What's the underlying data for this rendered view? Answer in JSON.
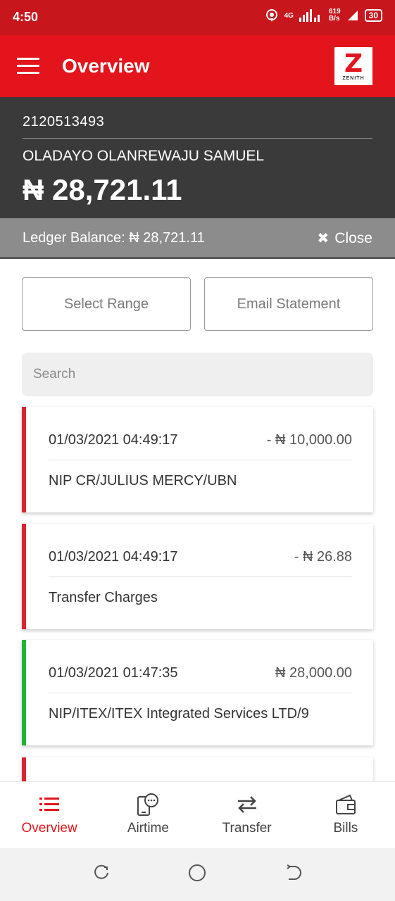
{
  "status_bar": {
    "time": "4:50",
    "network": "4G",
    "speed_value": "619",
    "speed_unit": "B/s",
    "battery": "30"
  },
  "header": {
    "title": "Overview",
    "logo_text": "ZENITH"
  },
  "account": {
    "number": "2120513493",
    "name": "OLADAYO OLANREWAJU SAMUEL",
    "balance": "₦ 28,721.11"
  },
  "ledger": {
    "label": "Ledger Balance: ₦ 28,721.11",
    "close_label": "Close"
  },
  "actions": {
    "select_range": "Select Range",
    "email_statement": "Email Statement"
  },
  "search": {
    "placeholder": "Search"
  },
  "transactions": [
    {
      "date": "01/03/2021 04:49:17",
      "amount": "- ₦ 10,000.00",
      "description": "NIP CR/JULIUS MERCY/UBN",
      "type": "debit"
    },
    {
      "date": "01/03/2021 04:49:17",
      "amount": "- ₦ 26.88",
      "description": "Transfer Charges",
      "type": "debit"
    },
    {
      "date": "01/03/2021 01:47:35",
      "amount": "₦ 28,000.00",
      "description": "NIP/ITEX/ITEX Integrated Services LTD/9",
      "type": "credit"
    }
  ],
  "bottom_nav": [
    {
      "label": "Overview",
      "icon": "list-icon",
      "active": true
    },
    {
      "label": "Airtime",
      "icon": "phone-chat-icon",
      "active": false
    },
    {
      "label": "Transfer",
      "icon": "transfer-arrows-icon",
      "active": false
    },
    {
      "label": "Bills",
      "icon": "wallet-icon",
      "active": false
    }
  ],
  "colors": {
    "brand_red": "#e3141c",
    "debit": "#d6262e",
    "credit": "#22b33a",
    "account_bg": "#3a3a3a",
    "ledger_bg": "#8c8c8c"
  }
}
